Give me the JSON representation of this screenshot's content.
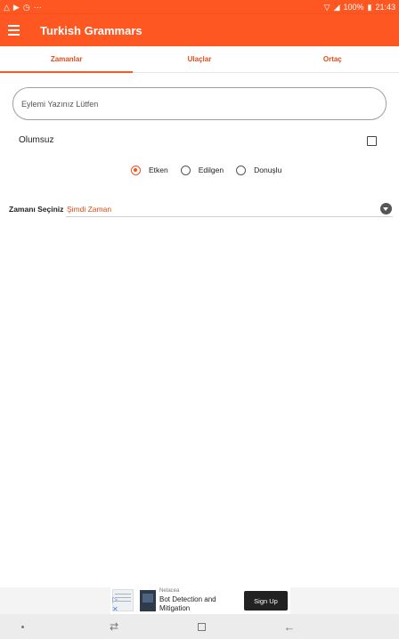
{
  "status_bar": {
    "left_icons": [
      "android-icon",
      "play-icon",
      "alarm-icon",
      "more-icon"
    ],
    "battery": "100%",
    "time": "21:43"
  },
  "app_bar": {
    "title": "Turkish Grammars"
  },
  "tabs": [
    {
      "label": "Zamanlar",
      "active": true
    },
    {
      "label": "Ulaçlar",
      "active": false
    },
    {
      "label": "Ortaç",
      "active": false
    }
  ],
  "verb_input": {
    "placeholder": "Eylemi Yazınız Lütfen",
    "value": ""
  },
  "negative": {
    "label": "Olumsuz",
    "checked": false
  },
  "voice_options": [
    {
      "label": "Etken",
      "checked": true
    },
    {
      "label": "Edilgen",
      "checked": false
    },
    {
      "label": "Donuşlu",
      "checked": false
    }
  ],
  "tense": {
    "label": "Zamanı Seçiniz",
    "selected": "Şimdi Zaman"
  },
  "ad": {
    "company": "Netacea",
    "headline": "Bot Detection and Mitigation",
    "cta": "Sign Up"
  },
  "colors": {
    "primary": "#ff5722",
    "accent_text": "#e64a19"
  }
}
